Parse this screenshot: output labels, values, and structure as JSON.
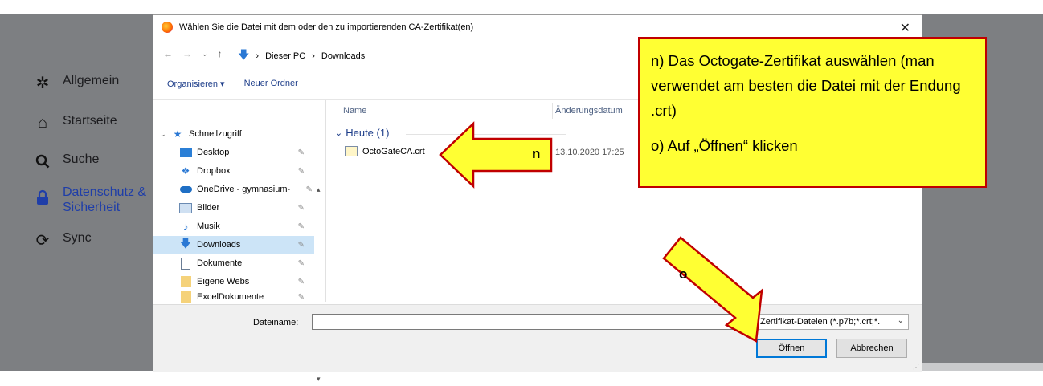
{
  "browser_sidebar": {
    "items": [
      {
        "label": "Allgemein",
        "icon": "gear-icon"
      },
      {
        "label": "Startseite",
        "icon": "home-icon"
      },
      {
        "label": "Suche",
        "icon": "search-icon"
      },
      {
        "label": "Datenschutz &",
        "label2": "Sicherheit",
        "icon": "lock-icon"
      },
      {
        "label": "Sync",
        "icon": "sync-icon"
      }
    ]
  },
  "dialog": {
    "title": "Wählen Sie die Datei mit dem oder den zu importierenden CA-Zertifikat(en)",
    "close": "✕",
    "path": [
      "Dieser PC",
      "Downloads"
    ],
    "toolbar": {
      "organize": "Organisieren ▾",
      "new_folder": "Neuer Ordner"
    },
    "tree": [
      {
        "label": "Schnellzugriff",
        "icon": "star-icon",
        "pinned": false
      },
      {
        "label": "Desktop",
        "icon": "desktop-icon",
        "pinned": true
      },
      {
        "label": "Dropbox",
        "icon": "dropbox-icon",
        "pinned": true
      },
      {
        "label": "OneDrive - gymnasium-",
        "icon": "cloud-icon",
        "pinned": true
      },
      {
        "label": "Bilder",
        "icon": "pictures-icon",
        "pinned": true
      },
      {
        "label": "Musik",
        "icon": "music-icon",
        "pinned": true
      },
      {
        "label": "Downloads",
        "icon": "download-icon",
        "pinned": true,
        "selected": true
      },
      {
        "label": "Dokumente",
        "icon": "document-icon",
        "pinned": true
      },
      {
        "label": "Eigene Webs",
        "icon": "folder-icon",
        "pinned": true
      },
      {
        "label": "ExcelDokumente",
        "icon": "folder-icon",
        "pinned": true
      }
    ],
    "columns": {
      "name": "Name",
      "date": "Änderungsdatum"
    },
    "group": "Heute (1)",
    "files": [
      {
        "name": "OctoGateCA.crt",
        "date": "13.10.2020 17:25"
      }
    ],
    "filename_label": "Dateiname:",
    "filename_value": "",
    "filter": "Zertifikat-Dateien (*.p7b;*.crt;*.",
    "open_button": "Öffnen",
    "cancel_button": "Abbrechen"
  },
  "annotations": {
    "callout_n": "n) Das Octogate-Zertifikat auswählen (man verwendet am besten die Datei mit der Endung .crt)",
    "callout_o": "o) Auf „Öffnen“ klicken",
    "arrow_n_label": "n",
    "arrow_o_label": "o",
    "colors": {
      "fill": "#ffff33",
      "border": "#c00000"
    }
  }
}
